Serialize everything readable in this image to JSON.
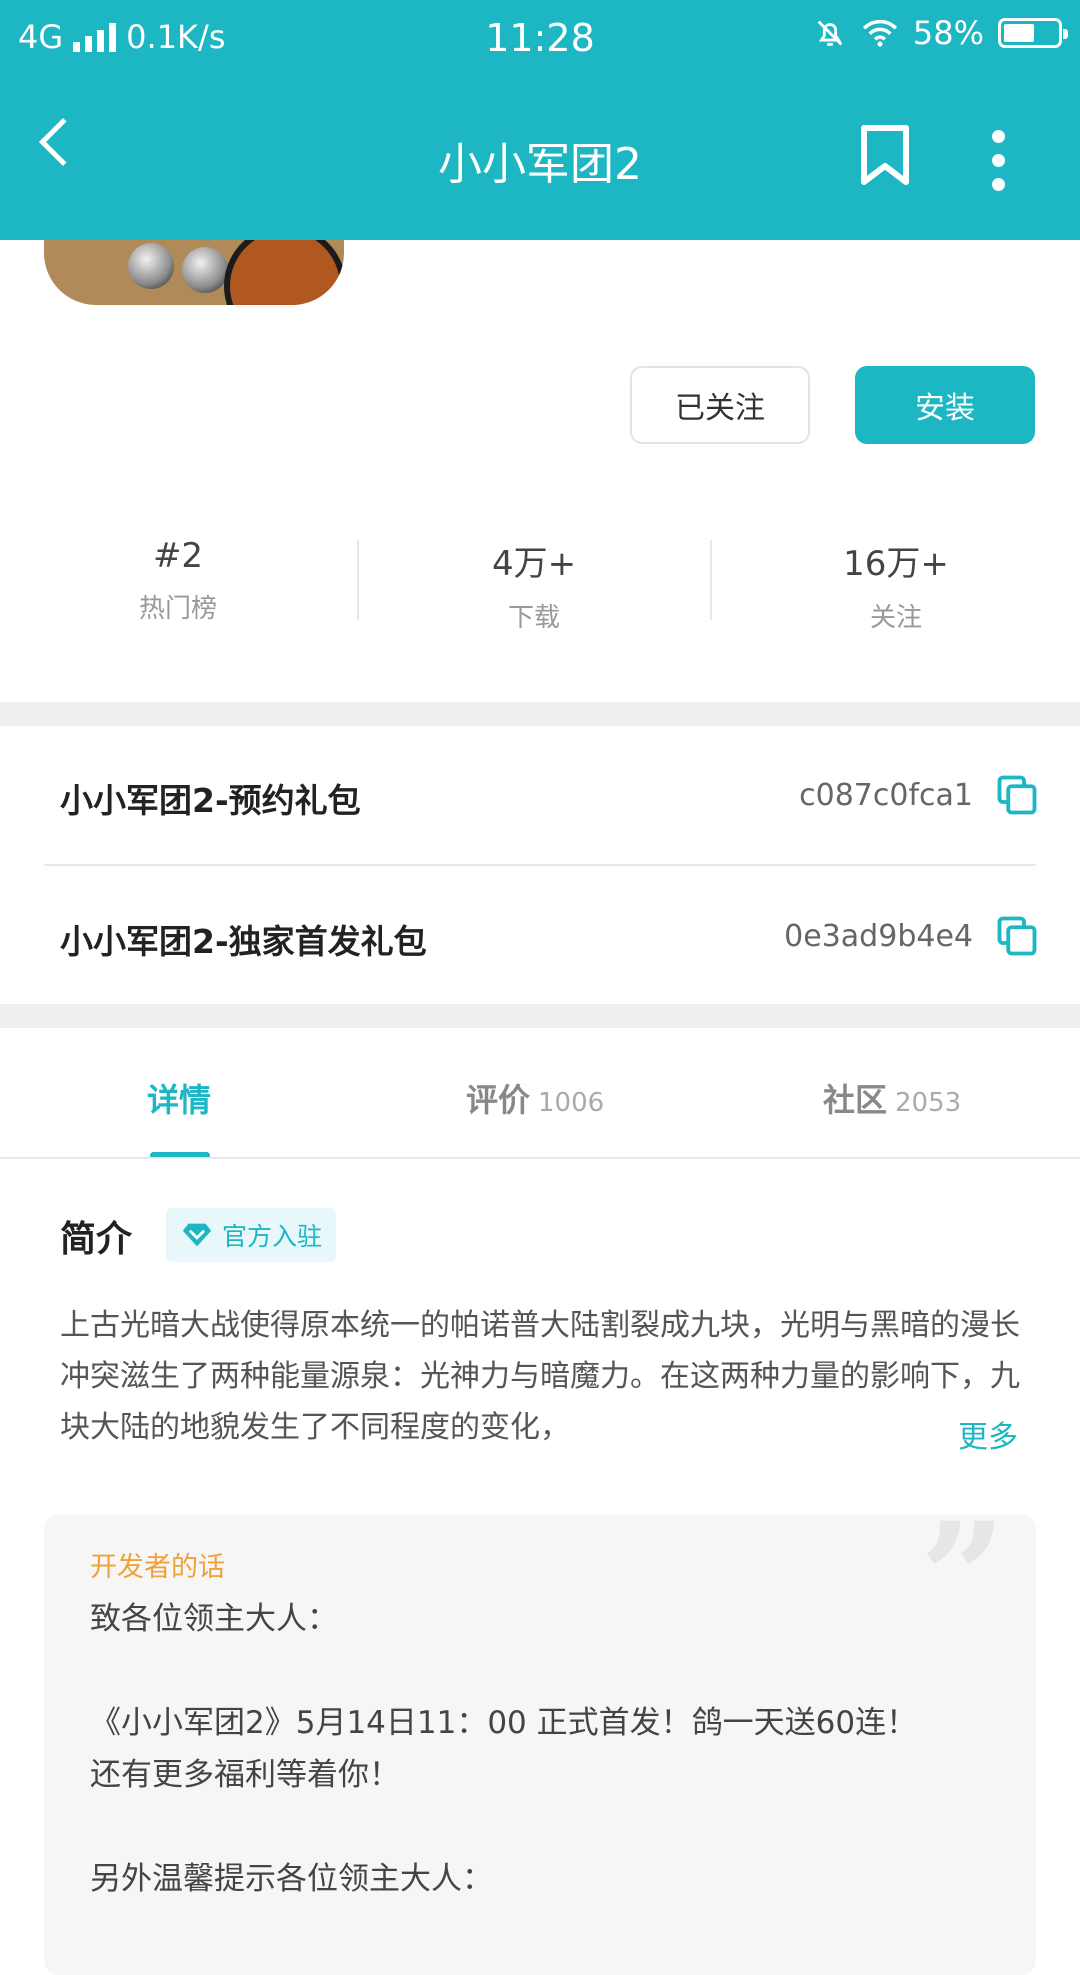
{
  "status_bar": {
    "network": "4G",
    "speed": "0.1K/s",
    "time": "11:28",
    "battery": "58%",
    "battery_level": 0.58
  },
  "header": {
    "title": "小小军团2"
  },
  "actions": {
    "follow_label": "已关注",
    "install_label": "安装"
  },
  "stats": [
    {
      "value": "#2",
      "label": "热门榜"
    },
    {
      "value": "4万+",
      "label": "下载"
    },
    {
      "value": "16万+",
      "label": "关注"
    }
  ],
  "gifts": [
    {
      "name": "小小军团2-预约礼包",
      "code": "c087c0fca1"
    },
    {
      "name": "小小军团2-独家首发礼包",
      "code": "0e3ad9b4e4"
    }
  ],
  "tabs": [
    {
      "label": "详情",
      "count": ""
    },
    {
      "label": "评价",
      "count": "1006"
    },
    {
      "label": "社区",
      "count": "2053"
    }
  ],
  "intro": {
    "title": "简介",
    "badge": "官方入驻",
    "text": "上古光暗大战使得原本统一的帕诺普大陆割裂成九块，光明与黑暗的漫长冲突滋生了两种能量源泉：光神力与暗魔力。在这两种力量的影响下，九块大陆的地貌发生了不同程度的变化，",
    "more": "更多"
  },
  "developer": {
    "label": "开发者的话",
    "lines": [
      "致各位领主大人：",
      "",
      "《小小军团2》5月14日11：00 正式首发！鸽一天送60连！",
      "还有更多福利等着你！",
      "",
      "另外温馨提示各位领主大人："
    ]
  },
  "colors": {
    "accent": "#1db6c3",
    "dev_label": "#f0a13a"
  }
}
